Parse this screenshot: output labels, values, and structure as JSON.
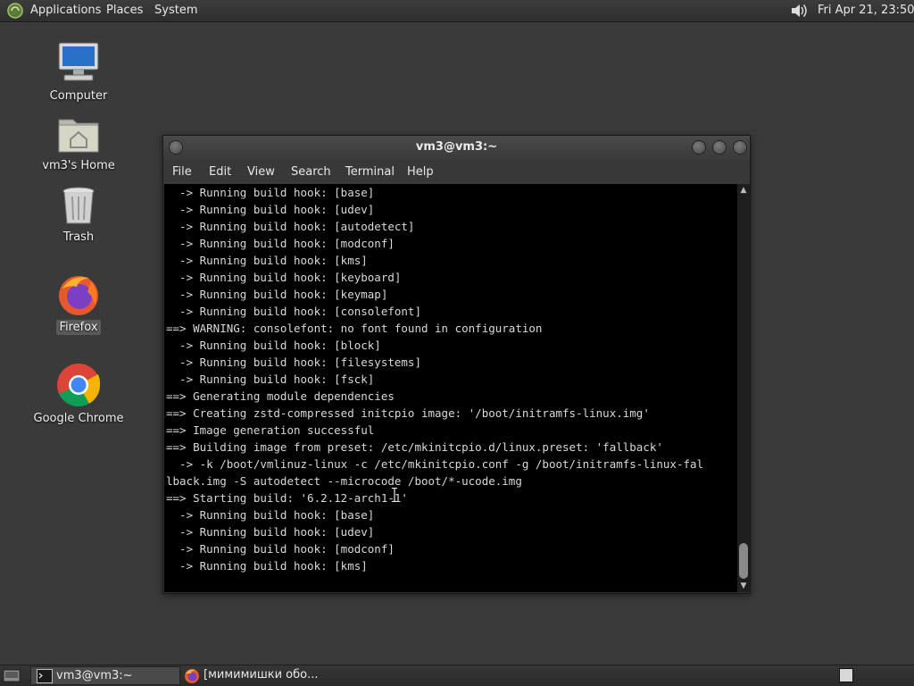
{
  "top_panel": {
    "menus": [
      "Applications",
      "Places",
      "System"
    ],
    "clock": "Fri Apr 21, 23:50",
    "icons": {
      "apps": "mate-logo-icon",
      "volume": "volume-icon"
    }
  },
  "desktop": {
    "icons": [
      {
        "label": "Computer",
        "icon": "computer-icon"
      },
      {
        "label": "vm3's Home",
        "icon": "home-folder-icon"
      },
      {
        "label": "Trash",
        "icon": "trash-icon"
      },
      {
        "label": "Firefox",
        "icon": "firefox-icon",
        "selected": true
      },
      {
        "label": "Google Chrome",
        "icon": "chrome-icon"
      }
    ]
  },
  "terminal": {
    "title": "vm3@vm3:~",
    "menu": [
      "File",
      "Edit",
      "View",
      "Search",
      "Terminal",
      "Help"
    ],
    "lines": [
      "  -> Running build hook: [base]",
      "  -> Running build hook: [udev]",
      "  -> Running build hook: [autodetect]",
      "  -> Running build hook: [modconf]",
      "  -> Running build hook: [kms]",
      "  -> Running build hook: [keyboard]",
      "  -> Running build hook: [keymap]",
      "  -> Running build hook: [consolefont]",
      "==> WARNING: consolefont: no font found in configuration",
      "  -> Running build hook: [block]",
      "  -> Running build hook: [filesystems]",
      "  -> Running build hook: [fsck]",
      "==> Generating module dependencies",
      "==> Creating zstd-compressed initcpio image: '/boot/initramfs-linux.img'",
      "==> Image generation successful",
      "==> Building image from preset: /etc/mkinitcpio.d/linux.preset: 'fallback'",
      "  -> -k /boot/vmlinuz-linux -c /etc/mkinitcpio.conf -g /boot/initramfs-linux-fal",
      "lback.img -S autodetect --microcode /boot/*-ucode.img",
      "==> Starting build: '6.2.12-arch1-1'",
      "  -> Running build hook: [base]",
      "  -> Running build hook: [udev]",
      "  -> Running build hook: [modconf]",
      "  -> Running build hook: [kms]"
    ]
  },
  "taskbar": {
    "tasks": [
      {
        "label": "vm3@vm3:~",
        "icon": "terminal-icon",
        "active": true
      },
      {
        "label": "[мимимишки обо...",
        "icon": "firefox-icon",
        "active": false
      }
    ],
    "icons": {
      "show_desktop": "show-desktop-icon",
      "workspace": "workspace-switcher-icon"
    }
  },
  "colors": {
    "desktop_bg": "#3a3a3a",
    "panel_bg": "#2e2e2e",
    "terminal_bg": "#000000",
    "terminal_fg": "#d8d8d8"
  }
}
